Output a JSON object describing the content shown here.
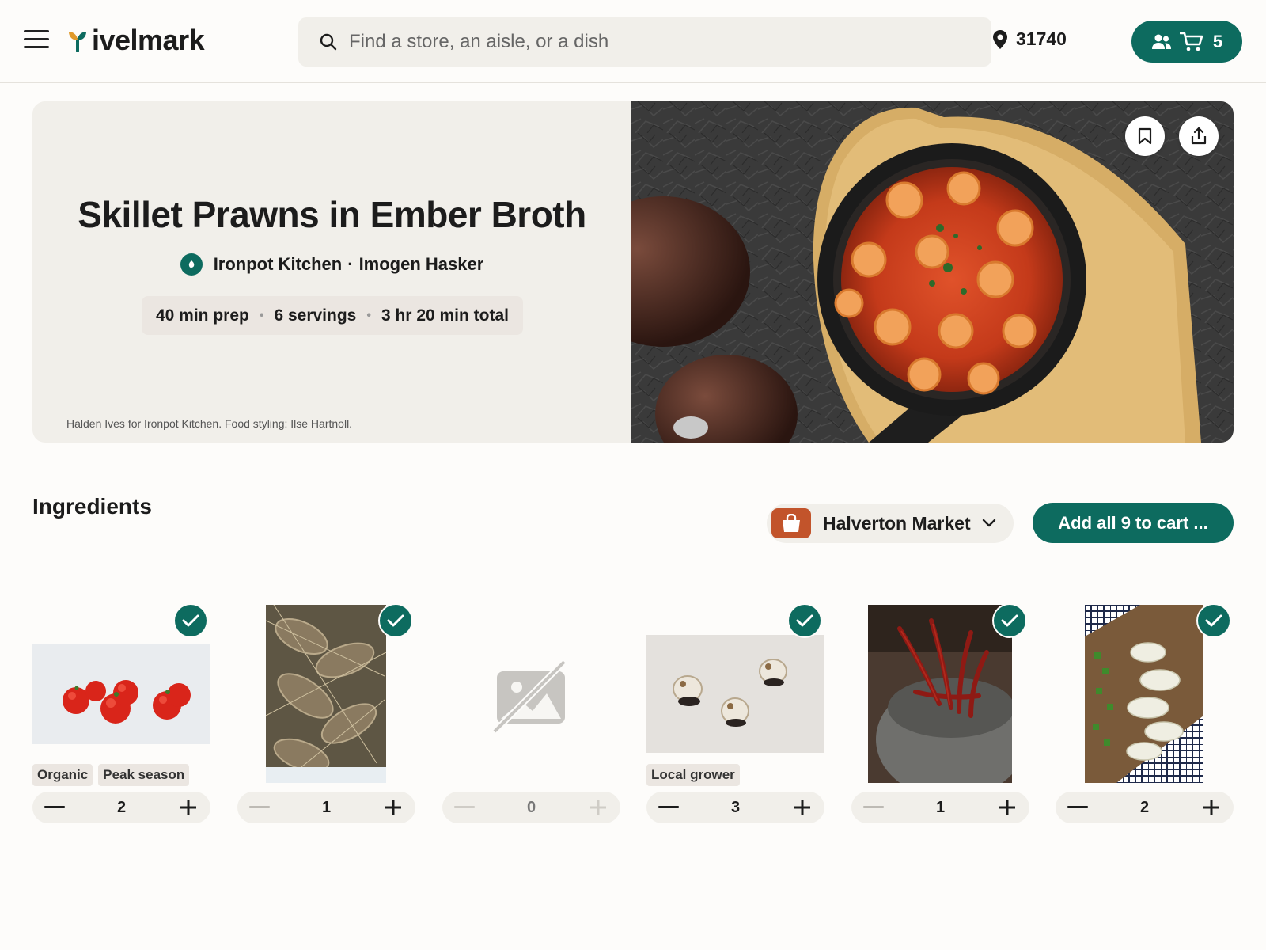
{
  "header": {
    "brand": "ivelmark",
    "search_placeholder": "Find a store, an aisle, or a dish",
    "zip": "31740",
    "cart_count": "5"
  },
  "hero": {
    "title": "Skillet Prawns in Ember Broth",
    "source": "Ironpot Kitchen",
    "separator": "·",
    "author": "Imogen Hasker",
    "prep": "40 min prep",
    "servings": "6 servings",
    "total": "3 hr 20 min total",
    "meta_dot": "•",
    "photo_credit": "Halden Ives for Ironpot Kitchen. Food styling: Ilse Hartnoll."
  },
  "ingredients": {
    "title": "Ingredients",
    "store": "Halverton Market",
    "add_all_label": "Add all 9 to cart ...",
    "items": [
      {
        "image": "tomatoes",
        "checked": true,
        "tags": [
          "Organic",
          "Peak season"
        ],
        "qty": "2",
        "minus_enabled": true
      },
      {
        "image": "prawns",
        "checked": true,
        "tags": [],
        "qty": "1",
        "minus_enabled": false
      },
      {
        "image": "no-image",
        "checked": false,
        "tags": [],
        "qty": "0",
        "minus_enabled": false,
        "plus_enabled": false
      },
      {
        "image": "garlic",
        "checked": true,
        "tags": [
          "Local grower"
        ],
        "qty": "3",
        "minus_enabled": true
      },
      {
        "image": "dried-chiles",
        "checked": true,
        "tags": [],
        "qty": "1",
        "minus_enabled": false
      },
      {
        "image": "sliced-onion",
        "checked": true,
        "tags": [],
        "qty": "2",
        "minus_enabled": true
      }
    ]
  },
  "colors": {
    "accent": "#0d6b5f",
    "store_brand": "#c2542b",
    "panel": "#f1efea",
    "pill": "#ebe6e1"
  }
}
